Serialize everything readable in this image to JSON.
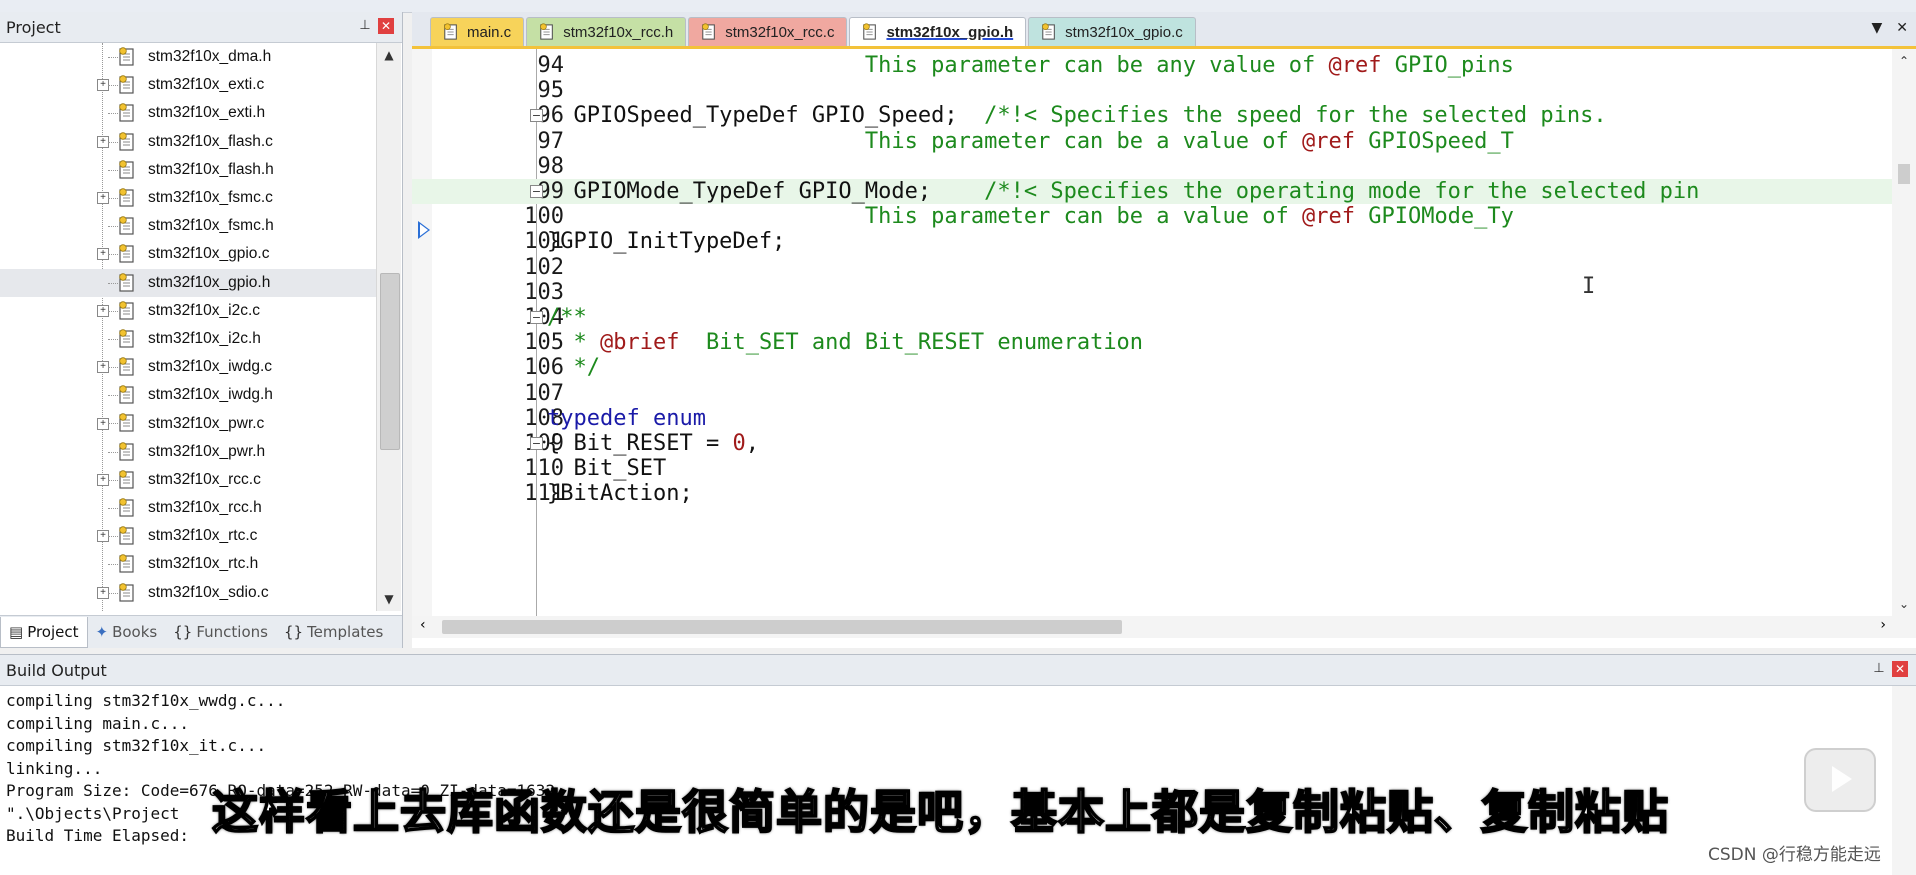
{
  "project_panel": {
    "title": "Project",
    "files": [
      {
        "name": "stm32f10x_dma.h",
        "expandable": false
      },
      {
        "name": "stm32f10x_exti.c",
        "expandable": true
      },
      {
        "name": "stm32f10x_exti.h",
        "expandable": false
      },
      {
        "name": "stm32f10x_flash.c",
        "expandable": true
      },
      {
        "name": "stm32f10x_flash.h",
        "expandable": false
      },
      {
        "name": "stm32f10x_fsmc.c",
        "expandable": true
      },
      {
        "name": "stm32f10x_fsmc.h",
        "expandable": false
      },
      {
        "name": "stm32f10x_gpio.c",
        "expandable": true
      },
      {
        "name": "stm32f10x_gpio.h",
        "expandable": false,
        "selected": true
      },
      {
        "name": "stm32f10x_i2c.c",
        "expandable": true
      },
      {
        "name": "stm32f10x_i2c.h",
        "expandable": false
      },
      {
        "name": "stm32f10x_iwdg.c",
        "expandable": true
      },
      {
        "name": "stm32f10x_iwdg.h",
        "expandable": false
      },
      {
        "name": "stm32f10x_pwr.c",
        "expandable": true
      },
      {
        "name": "stm32f10x_pwr.h",
        "expandable": false
      },
      {
        "name": "stm32f10x_rcc.c",
        "expandable": true
      },
      {
        "name": "stm32f10x_rcc.h",
        "expandable": false
      },
      {
        "name": "stm32f10x_rtc.c",
        "expandable": true
      },
      {
        "name": "stm32f10x_rtc.h",
        "expandable": false
      },
      {
        "name": "stm32f10x_sdio.c",
        "expandable": true
      }
    ],
    "tabs": [
      {
        "label": "Project",
        "icon": "project-icon",
        "active": true
      },
      {
        "label": "Books",
        "icon": "books-icon",
        "active": false
      },
      {
        "label": "Functions",
        "icon": "functions-icon",
        "active": false
      },
      {
        "label": "Templates",
        "icon": "templates-icon",
        "active": false
      }
    ]
  },
  "editor": {
    "tabs": [
      {
        "label": "main.c",
        "color": "#f7d35a",
        "active": false
      },
      {
        "label": "stm32f10x_rcc.h",
        "color": "#c5e0a5",
        "active": false
      },
      {
        "label": "stm32f10x_rcc.c",
        "color": "#f0a8a0",
        "active": false
      },
      {
        "label": "stm32f10x_gpio.h",
        "color": "#ffffff",
        "active": true
      },
      {
        "label": "stm32f10x_gpio.c",
        "color": "#bfe3df",
        "active": false
      }
    ],
    "lines": [
      {
        "num": "94",
        "fold": "",
        "segments": [
          {
            "t": "                        ",
            "c": ""
          },
          {
            "t": "This parameter can be any value of ",
            "c": "cmt"
          },
          {
            "t": "@ref",
            "c": "ref"
          },
          {
            "t": " GPIO_pins",
            "c": "cmt"
          }
        ]
      },
      {
        "num": "95",
        "fold": "",
        "segments": []
      },
      {
        "num": "96",
        "fold": "⊟",
        "segments": [
          {
            "t": "  GPIOSpeed_TypeDef GPIO_Speed;  ",
            "c": ""
          },
          {
            "t": "/*!< Specifies the speed for the selected pins.",
            "c": "cmt"
          }
        ]
      },
      {
        "num": "97",
        "fold": "",
        "segments": [
          {
            "t": "                        ",
            "c": ""
          },
          {
            "t": "This parameter can be a value of ",
            "c": "cmt"
          },
          {
            "t": "@ref",
            "c": "ref"
          },
          {
            "t": " GPIOSpeed_T",
            "c": "cmt"
          }
        ]
      },
      {
        "num": "98",
        "fold": "",
        "segments": []
      },
      {
        "num": "99",
        "fold": "⊟",
        "highlight": true,
        "segments": [
          {
            "t": "  GPIOMode_TypeDef GPIO_Mode;    ",
            "c": ""
          },
          {
            "t": "/*!< Specifies the operating mode for the selected pin",
            "c": "cmt"
          }
        ]
      },
      {
        "num": "100",
        "fold": "",
        "segments": [
          {
            "t": "                        ",
            "c": ""
          },
          {
            "t": "This parameter can be a value of ",
            "c": "cmt"
          },
          {
            "t": "@ref",
            "c": "ref"
          },
          {
            "t": " GPIOMode_Ty",
            "c": "cmt"
          }
        ]
      },
      {
        "num": "101",
        "fold": "",
        "segments": [
          {
            "t": "}GPIO_InitTypeDef;",
            "c": ""
          }
        ]
      },
      {
        "num": "102",
        "fold": "",
        "segments": []
      },
      {
        "num": "103",
        "fold": "",
        "segments": []
      },
      {
        "num": "104",
        "fold": "⊟",
        "segments": [
          {
            "t": "/**",
            "c": "cmt"
          }
        ]
      },
      {
        "num": "105",
        "fold": "",
        "segments": [
          {
            "t": "  * ",
            "c": "cmt"
          },
          {
            "t": "@brief",
            "c": "ref"
          },
          {
            "t": "  Bit_SET and Bit_RESET enumeration",
            "c": "cmt"
          }
        ]
      },
      {
        "num": "106",
        "fold": "",
        "segments": [
          {
            "t": "  */",
            "c": "cmt"
          }
        ]
      },
      {
        "num": "107",
        "fold": "",
        "segments": []
      },
      {
        "num": "108",
        "fold": "",
        "segments": [
          {
            "t": "typedef enum",
            "c": "kw"
          }
        ]
      },
      {
        "num": "109",
        "fold": "⊟",
        "segments": [
          {
            "t": "{ Bit_RESET = ",
            "c": ""
          },
          {
            "t": "0",
            "c": "num"
          },
          {
            "t": ",",
            "c": ""
          }
        ]
      },
      {
        "num": "110",
        "fold": "",
        "segments": [
          {
            "t": "  Bit_SET",
            "c": ""
          }
        ]
      },
      {
        "num": "111",
        "fold": "",
        "segments": [
          {
            "t": "}BitAction;",
            "c": ""
          }
        ]
      }
    ]
  },
  "build_output": {
    "title": "Build Output",
    "lines": [
      "compiling stm32f10x_wwdg.c...",
      "compiling main.c...",
      "compiling stm32f10x_it.c...",
      "linking...",
      "Program Size: Code=676 RO-data=252 RW-data=0 ZI-data=1632",
      "\".\\Objects\\Project",
      "Build Time Elapsed:"
    ]
  },
  "overlay": {
    "subtitle": "这样看上去库函数还是很简单的是吧，基本上都是复制粘贴、复制粘贴",
    "watermark": "CSDN @行稳方能走远"
  }
}
